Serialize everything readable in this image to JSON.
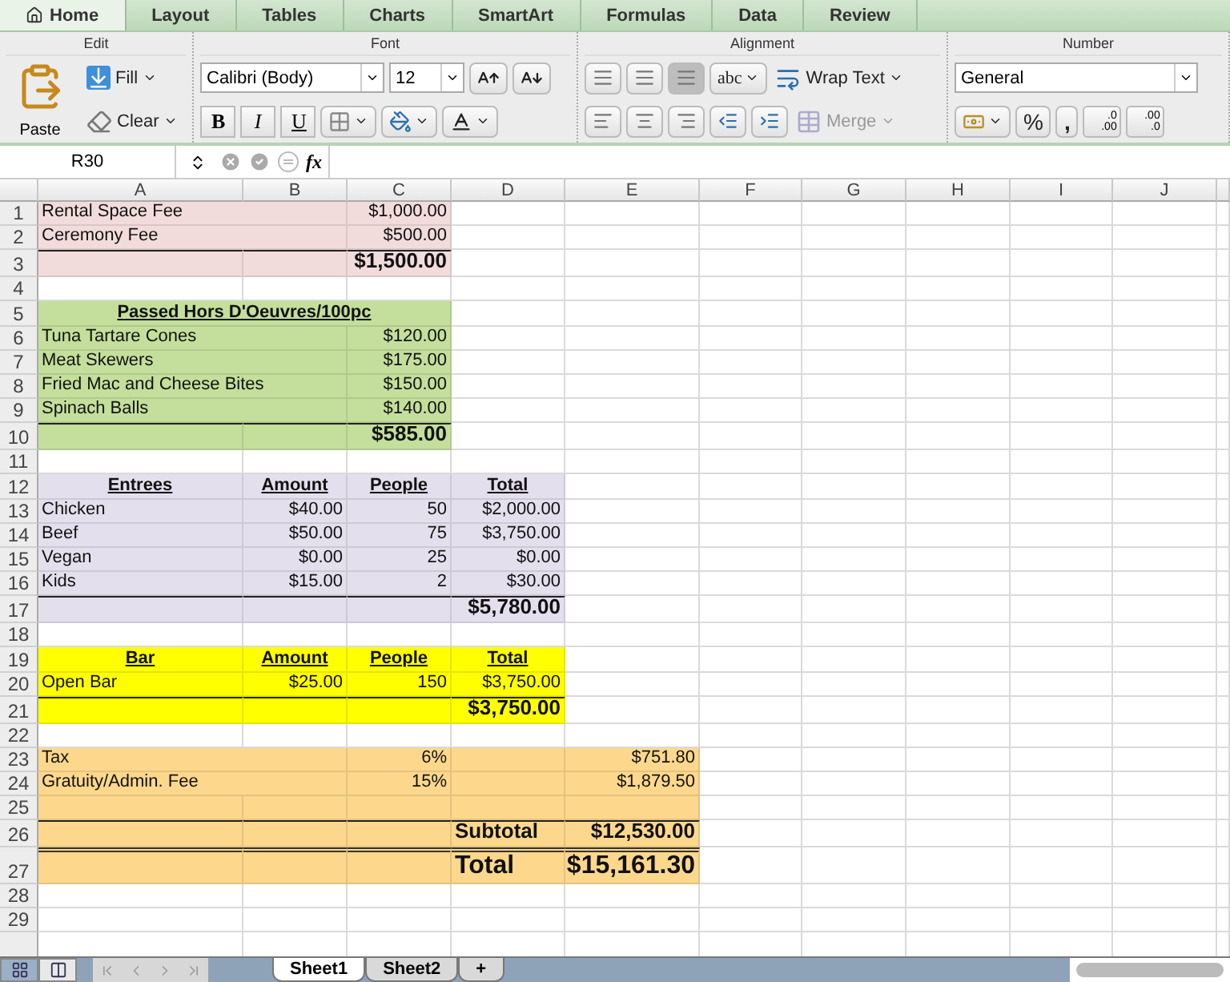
{
  "ribbon": {
    "tabs": [
      {
        "label": "Home",
        "selected": true
      },
      {
        "label": "Layout",
        "selected": false
      },
      {
        "label": "Tables",
        "selected": false
      },
      {
        "label": "Charts",
        "selected": false
      },
      {
        "label": "SmartArt",
        "selected": false
      },
      {
        "label": "Formulas",
        "selected": false
      },
      {
        "label": "Data",
        "selected": false
      },
      {
        "label": "Review",
        "selected": false
      }
    ],
    "edit": {
      "title": "Edit",
      "paste": "Paste",
      "fill": "Fill",
      "clear": "Clear"
    },
    "font": {
      "title": "Font",
      "font_name": "Calibri (Body)",
      "font_size": "12",
      "bold": "B",
      "italic": "I",
      "underline": "U"
    },
    "alignment": {
      "title": "Alignment",
      "orientation": "abc",
      "wrap": "Wrap Text",
      "merge": {
        "label": "Merge",
        "disabled": true
      }
    },
    "number": {
      "title": "Number",
      "format": "General",
      "percent": "%",
      "comma": ",",
      "increase_decimal": [
        ".0",
        ".00"
      ],
      "decrease_decimal": [
        ".00",
        ".0"
      ]
    }
  },
  "formula_bar": {
    "name_box": "R30",
    "fx": "fx"
  },
  "columns": [
    "A",
    "B",
    "C",
    "D",
    "E",
    "F",
    "G",
    "H",
    "I",
    "J"
  ],
  "blocks": [
    {
      "color": "#f2dcdb",
      "rows": [
        {
          "num": "1",
          "kind": "item",
          "a": "Rental Space Fee",
          "c": "$1,000.00"
        },
        {
          "num": "2",
          "kind": "item",
          "a": "Ceremony Fee",
          "c": "$500.00"
        },
        {
          "num": "3",
          "kind": "total",
          "c": "$1,500.00"
        }
      ]
    },
    {
      "rows": [
        {
          "num": "4",
          "kind": "item"
        }
      ]
    },
    {
      "color": "#c4df9b",
      "rows": [
        {
          "num": "5",
          "kind": "header",
          "a": "Passed Hors D'Oeuvres/100pc"
        },
        {
          "num": "6",
          "kind": "item",
          "a": "Tuna Tartare Cones",
          "c": "$120.00"
        },
        {
          "num": "7",
          "kind": "item",
          "a": "Meat Skewers",
          "c": "$175.00"
        },
        {
          "num": "8",
          "kind": "item",
          "a": "Fried Mac and Cheese Bites",
          "c": "$150.00"
        },
        {
          "num": "9",
          "kind": "item",
          "a": "Spinach Balls",
          "c": "$140.00"
        },
        {
          "num": "10",
          "kind": "total",
          "c": "$585.00"
        }
      ]
    },
    {
      "rows": [
        {
          "num": "11",
          "kind": "item"
        }
      ]
    },
    {
      "color": "#e4dfec",
      "rows": [
        {
          "num": "12",
          "kind": "header",
          "a": "Entrees",
          "b": "Amount",
          "c": "People",
          "d": "Total"
        },
        {
          "num": "13",
          "kind": "item",
          "a": "Chicken",
          "b": "$40.00",
          "c": "50",
          "d": "$2,000.00"
        },
        {
          "num": "14",
          "kind": "item",
          "a": "Beef",
          "b": "$50.00",
          "c": "75",
          "d": "$3,750.00"
        },
        {
          "num": "15",
          "kind": "item",
          "a": "Vegan",
          "b": "$0.00",
          "c": "25",
          "d": "$0.00"
        },
        {
          "num": "16",
          "kind": "item",
          "a": "Kids",
          "b": "$15.00",
          "c": "2",
          "d": "$30.00"
        },
        {
          "num": "17",
          "kind": "total",
          "d": "$5,780.00"
        }
      ]
    },
    {
      "rows": [
        {
          "num": "18",
          "kind": "item"
        }
      ]
    },
    {
      "color": "#ffff00",
      "rows": [
        {
          "num": "19",
          "kind": "header",
          "a": "Bar",
          "b": "Amount",
          "c": "People",
          "d": "Total"
        },
        {
          "num": "20",
          "kind": "item",
          "a": "Open Bar",
          "b": "$25.00",
          "c": "150",
          "d": "$3,750.00"
        },
        {
          "num": "21",
          "kind": "total",
          "d": "$3,750.00"
        }
      ]
    },
    {
      "rows": [
        {
          "num": "22",
          "kind": "item"
        }
      ]
    },
    {
      "color": "#fdd88c",
      "rows": [
        {
          "num": "23",
          "kind": "item",
          "a": "Tax",
          "c": "6%",
          "e": "$751.80"
        },
        {
          "num": "24",
          "kind": "item",
          "a": "Gratuity/Admin. Fee",
          "c": "15%",
          "e": "$1,879.50"
        },
        {
          "num": "25",
          "kind": "item"
        },
        {
          "num": "26",
          "kind": "total",
          "label": "Subtotal",
          "e": "$12,530.00"
        },
        {
          "num": "27",
          "kind": "grand",
          "label": "Total",
          "e": "$15,161.30"
        }
      ]
    },
    {
      "rows": [
        {
          "num": "28",
          "kind": "item"
        },
        {
          "num": "29",
          "kind": "item"
        }
      ]
    }
  ],
  "sheets": [
    {
      "label": "Sheet1",
      "selected": true
    },
    {
      "label": "Sheet2",
      "selected": false
    }
  ],
  "add_sheet": "+"
}
